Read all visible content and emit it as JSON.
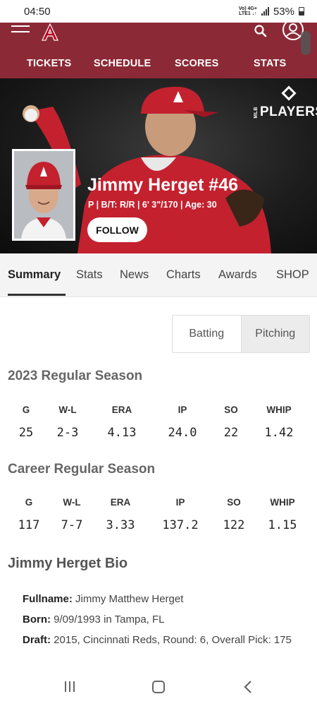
{
  "status_bar": {
    "time": "04:50",
    "network_top": "Vo) 4G+",
    "network_bottom": "LTE1 ↓↑",
    "battery": "53%"
  },
  "nav": {
    "items": [
      "TICKETS",
      "SCHEDULE",
      "SCORES",
      "STATS"
    ]
  },
  "hero": {
    "brand_small": "MLB",
    "brand_big": "PLAYERS",
    "player_name": "Jimmy Herget #46",
    "player_meta": "P | B/T: R/R | 6' 3\"/170 | Age: 30",
    "follow_label": "FOLLOW"
  },
  "tabs": [
    "Summary",
    "Stats",
    "News",
    "Charts",
    "Awards",
    "SHOP"
  ],
  "toggle": {
    "batting": "Batting",
    "pitching": "Pitching",
    "selected": "Pitching"
  },
  "season_2023": {
    "title": "2023 Regular Season",
    "headers": [
      "G",
      "W-L",
      "ERA",
      "IP",
      "SO",
      "WHIP"
    ],
    "values": [
      "25",
      "2-3",
      "4.13",
      "24.0",
      "22",
      "1.42"
    ]
  },
  "career": {
    "title": "Career Regular Season",
    "headers": [
      "G",
      "W-L",
      "ERA",
      "IP",
      "SO",
      "WHIP"
    ],
    "values": [
      "117",
      "7-7",
      "3.33",
      "137.2",
      "122",
      "1.15"
    ]
  },
  "bio": {
    "title": "Jimmy Herget Bio",
    "fullname_label": "Fullname:",
    "fullname": "Jimmy Matthew Herget",
    "born_label": "Born:",
    "born": "9/09/1993 in Tampa, FL",
    "draft_label": "Draft:",
    "draft": "2015, Cincinnati Reds, Round: 6, Overall Pick: 175"
  },
  "colors": {
    "brand": "#8b2a36",
    "hero_bg": "#1d1d1d"
  }
}
